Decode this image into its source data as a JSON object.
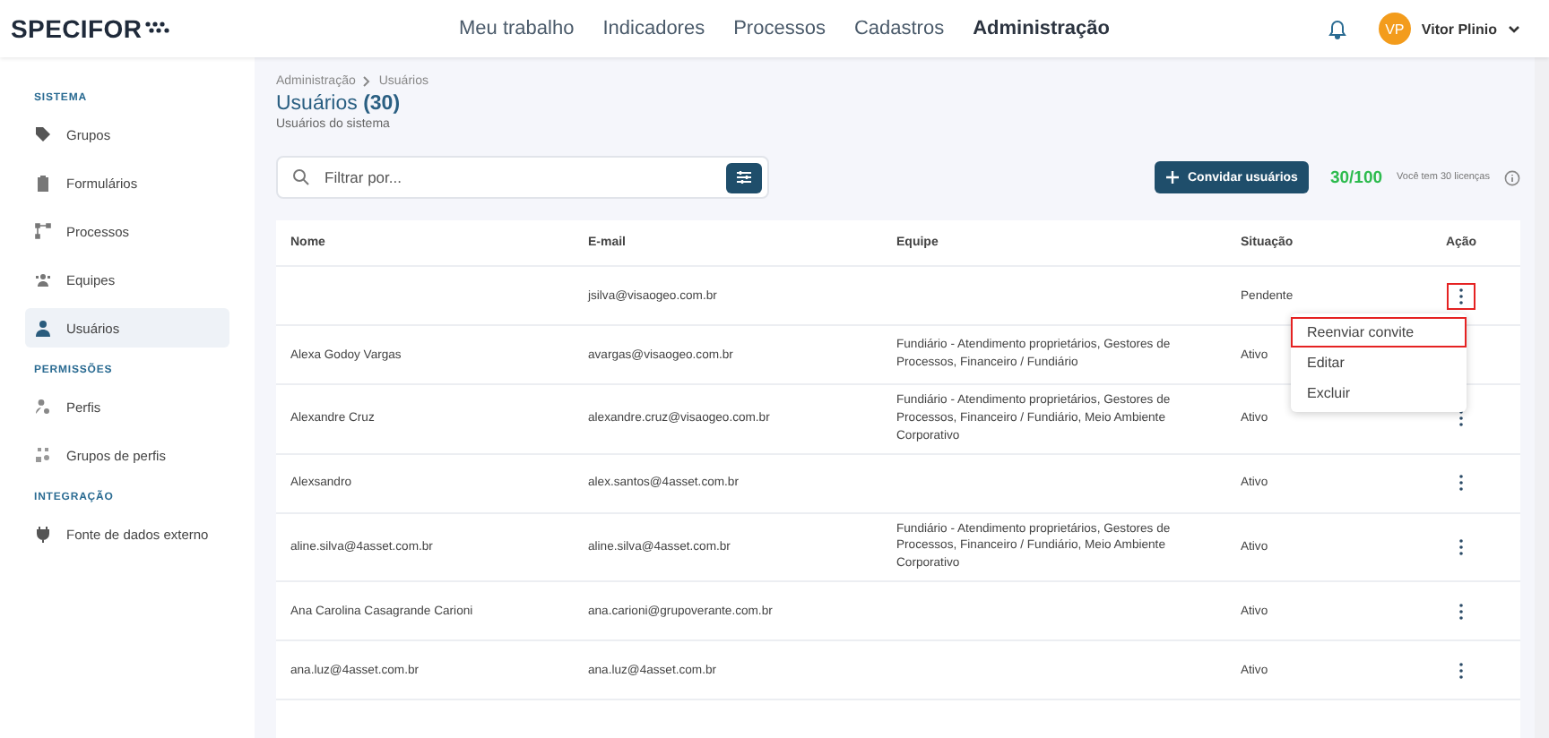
{
  "header": {
    "logo": "SPECIFOR",
    "nav": [
      {
        "label": "Meu trabalho",
        "selected": false
      },
      {
        "label": "Indicadores",
        "selected": false
      },
      {
        "label": "Processos",
        "selected": false
      },
      {
        "label": "Cadastros",
        "selected": false
      },
      {
        "label": "Administração",
        "selected": true
      }
    ],
    "user": {
      "initials": "VP",
      "name": "Vitor Plinio"
    }
  },
  "sidebar": {
    "sections": [
      {
        "title": "SISTEMA",
        "items": [
          {
            "label": "Grupos",
            "selected": false
          },
          {
            "label": "Formulários",
            "selected": false
          },
          {
            "label": "Processos",
            "selected": false
          },
          {
            "label": "Equipes",
            "selected": false
          },
          {
            "label": "Usuários",
            "selected": true
          }
        ]
      },
      {
        "title": "PERMISSÕES",
        "items": [
          {
            "label": "Perfis",
            "selected": false
          },
          {
            "label": "Grupos de perfis",
            "selected": false
          }
        ]
      },
      {
        "title": "INTEGRAÇÃO",
        "items": [
          {
            "label": "Fonte de dados externo",
            "selected": false
          }
        ]
      }
    ]
  },
  "breadcrumb": [
    "Administração",
    "Usuários"
  ],
  "page": {
    "title": "Usuários",
    "count": "(30)",
    "subtitle": "Usuários do sistema"
  },
  "search": {
    "placeholder": "Filtrar por..."
  },
  "invite_button": "Convidar usuários",
  "licenses": {
    "count": "30/100",
    "text": "Você tem 30 licenças"
  },
  "table": {
    "columns": [
      "Nome",
      "E-mail",
      "Equipe",
      "Situação",
      "Ação"
    ],
    "rows": [
      {
        "email": "jsilva@visaogeo.com.br",
        "status": "Pendente",
        "highlighted": true
      },
      {
        "name": "Alexa Godoy Vargas",
        "email": "avargas@visaogeo.com.br",
        "team": "Fundiário - Atendimento proprietários, Gestores de Processos, Financeiro / Fundiário",
        "status": "Ativo"
      },
      {
        "name": "Alexandre Cruz",
        "email": "alexandre.cruz@visaogeo.com.br",
        "team": "Fundiário - Atendimento proprietários, Gestores de Processos, Financeiro / Fundiário, Meio Ambiente Corporativo",
        "status": "Ativo",
        "highlighted": false
      },
      {
        "name": "Alexsandro",
        "email": "alex.santos@4asset.com.br",
        "status": "Ativo",
        "highlighted": false
      },
      {
        "name": "aline.silva@4asset.com.br",
        "email": "aline.silva@4asset.com.br",
        "team": "Fundiário - Atendimento proprietários, Gestores de Processos, Financeiro / Fundiário, Meio Ambiente Corporativo",
        "status": "Ativo",
        "highlighted": false
      },
      {
        "name": "Ana Carolina Casagrande Carioni",
        "email": "ana.carioni@grupoverante.com.br",
        "status": "Ativo",
        "highlighted": false
      },
      {
        "name": "ana.luz@4asset.com.br",
        "email": "ana.luz@4asset.com.br",
        "status": "Ativo",
        "highlighted": false
      }
    ]
  },
  "menu": {
    "items": [
      {
        "label": "Reenviar convite",
        "highlighted": true
      },
      {
        "label": "Editar",
        "highlighted": false
      },
      {
        "label": "Excluir",
        "highlighted": false
      }
    ]
  }
}
